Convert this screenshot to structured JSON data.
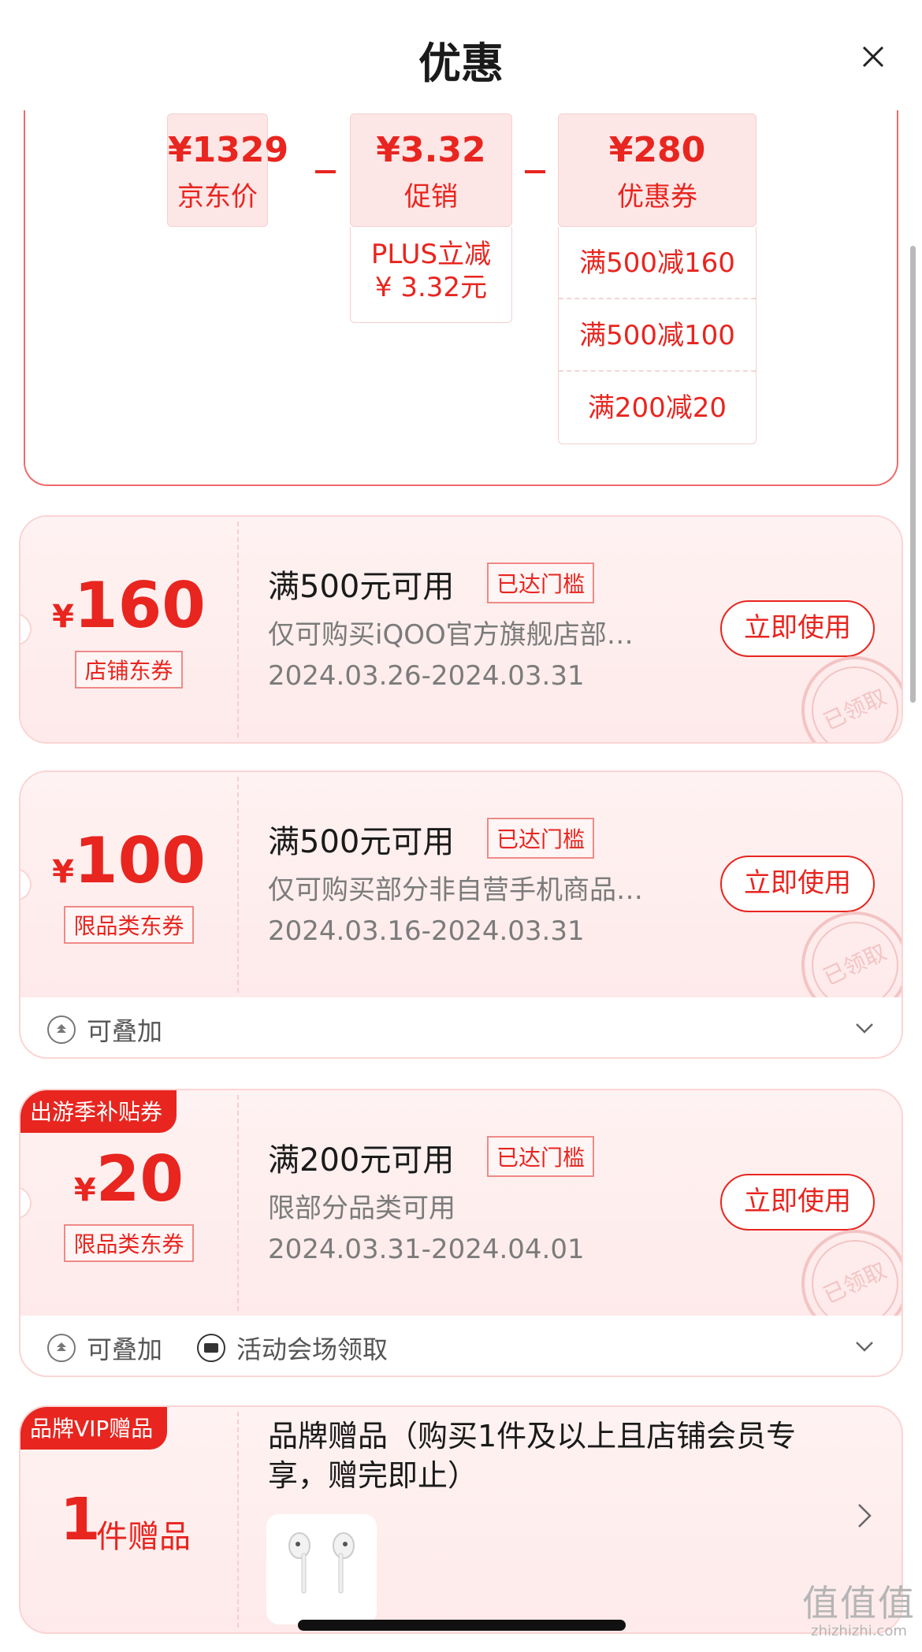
{
  "header": {
    "title": "优惠",
    "close_icon": "close-icon"
  },
  "breakdown": {
    "jd_price": {
      "amount": "¥1329",
      "label": "京东价"
    },
    "promo": {
      "amount": "¥3.32",
      "label": "促销",
      "detail_line1": "PLUS立减",
      "detail_line2": "¥ 3.32元"
    },
    "coupon": {
      "amount": "¥280",
      "label": "优惠券",
      "items": [
        "满500减160",
        "满500减100",
        "满200减20"
      ]
    }
  },
  "coupons": [
    {
      "yen": "¥",
      "value": "160",
      "type": "店铺东券",
      "title": "满500元可用",
      "badge": "已达门槛",
      "desc": "仅可购买iQOO官方旗舰店部…",
      "date": "2024.03.26-2024.03.31",
      "button": "立即使用",
      "stamp": "已领取"
    },
    {
      "yen": "¥",
      "value": "100",
      "type": "限品类东券",
      "title": "满500元可用",
      "badge": "已达门槛",
      "desc": "仅可购买部分非自营手机商品…",
      "date": "2024.03.16-2024.03.31",
      "button": "立即使用",
      "stamp": "已领取",
      "stackable": "可叠加"
    },
    {
      "ribbon": "出游季补贴券",
      "yen": "¥",
      "value": "20",
      "type": "限品类东券",
      "title": "满200元可用",
      "badge": "已达门槛",
      "desc": "限部分品类可用",
      "date": "2024.03.31-2024.04.01",
      "button": "立即使用",
      "stamp": "已领取",
      "stackable": "可叠加",
      "venue": "活动会场领取"
    }
  ],
  "gift": {
    "ribbon": "品牌VIP赠品",
    "qty": "1",
    "unit": "件赠品",
    "title": "品牌赠品（购买1件及以上且店铺会员专享，赠完即止）",
    "thumb_icon": "earphones-icon"
  },
  "watermark": {
    "text": "值值值",
    "domain": "zhizhizhi.com"
  },
  "colors": {
    "accent": "#e8251f",
    "card_bg": "#fff2f2",
    "border": "#fbd4d4"
  }
}
